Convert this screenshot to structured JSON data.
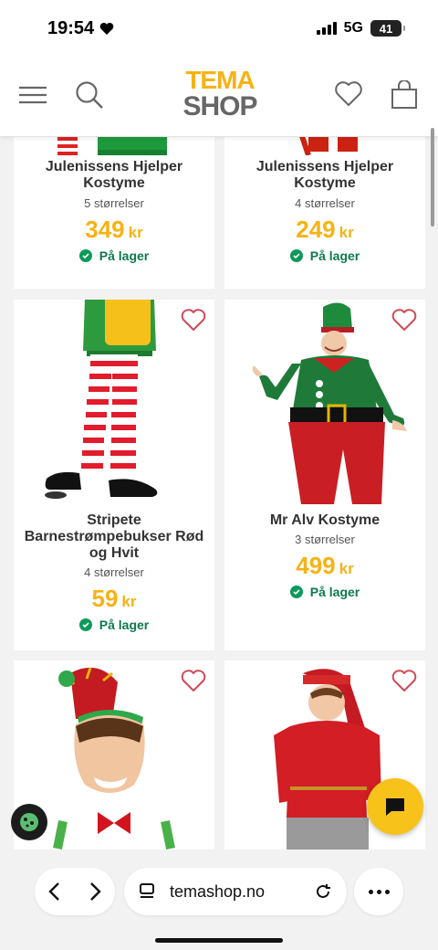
{
  "status": {
    "time": "19:54",
    "network": "5G",
    "battery": "41"
  },
  "header": {
    "logo_top": "TEMA",
    "logo_bottom": "SHOP"
  },
  "products": [
    {
      "title": "Julenissens Hjelper Kostyme",
      "sizes": "5 størrelser",
      "price": "349",
      "currency": "kr",
      "stock": "På lager"
    },
    {
      "title": "Julenissens Hjelper Kostyme",
      "sizes": "4 størrelser",
      "price": "249",
      "currency": "kr",
      "stock": "På lager"
    },
    {
      "title": "Stripete Barnestrømpebukser Rød og Hvit",
      "sizes": "4 størrelser",
      "price": "59",
      "currency": "kr",
      "stock": "På lager"
    },
    {
      "title": "Mr Alv Kostyme",
      "sizes": "3 størrelser",
      "price": "499",
      "currency": "kr",
      "stock": "På lager"
    }
  ],
  "browser": {
    "url": "temashop.no"
  },
  "colors": {
    "accent": "#f7b215",
    "stock_green": "#0c7a4a",
    "heart": "#d04a55",
    "chat": "#f7c31a"
  },
  "icons": [
    "menu-icon",
    "search-icon",
    "heart-icon",
    "bag-icon",
    "check-icon",
    "chat-icon",
    "cookie-icon",
    "back-icon",
    "forward-icon",
    "tabs-icon",
    "reload-icon",
    "more-icon"
  ]
}
